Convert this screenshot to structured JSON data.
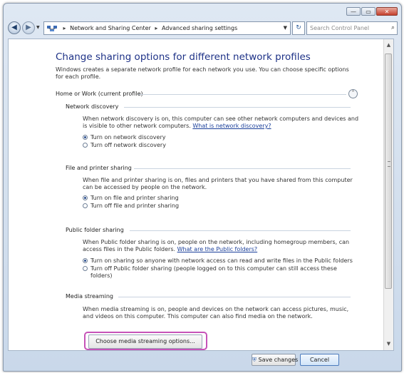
{
  "window": {
    "buttons": {
      "minimize": "—",
      "maximize": "▭",
      "close": "✕"
    }
  },
  "navigation": {
    "back_icon": "back-arrow-icon",
    "forward_icon": "forward-arrow-icon",
    "breadcrumb": [
      "Network and Sharing Center",
      "Advanced sharing settings"
    ],
    "search_placeholder": "Search Control Panel"
  },
  "page": {
    "title": "Change sharing options for different network profiles",
    "intro": "Windows creates a separate network profile for each network you use. You can choose specific options for each profile.",
    "profile_label": "Home or Work (current profile)"
  },
  "sections": {
    "network_discovery": {
      "heading": "Network discovery",
      "description": "When network discovery is on, this computer can see other network computers and devices and is visible to other network computers.",
      "link": "What is network discovery?",
      "options": [
        "Turn on network discovery",
        "Turn off network discovery"
      ],
      "selected": 0
    },
    "file_printer": {
      "heading": "File and printer sharing",
      "description": "When file and printer sharing is on, files and printers that you have shared from this computer can be accessed by people on the network.",
      "options": [
        "Turn on file and printer sharing",
        "Turn off file and printer sharing"
      ],
      "selected": 0
    },
    "public_folder": {
      "heading": "Public folder sharing",
      "description": "When Public folder sharing is on, people on the network, including homegroup members, can access files in the Public folders.",
      "link": "What are the Public folders?",
      "options": [
        "Turn on sharing so anyone with network access can read and write files in the Public folders",
        "Turn off Public folder sharing (people logged on to this computer can still access these folders)"
      ],
      "selected": 0
    },
    "media_streaming": {
      "heading": "Media streaming",
      "description": "When media streaming is on, people and devices on the network can access pictures, music, and videos on this computer. This computer can also find media on the network.",
      "button": "Choose media streaming options..."
    }
  },
  "footer": {
    "save": "Save changes",
    "cancel": "Cancel"
  },
  "colors": {
    "title": "#1e3287",
    "highlight": "#c653b8",
    "link": "#1a3f9a"
  }
}
